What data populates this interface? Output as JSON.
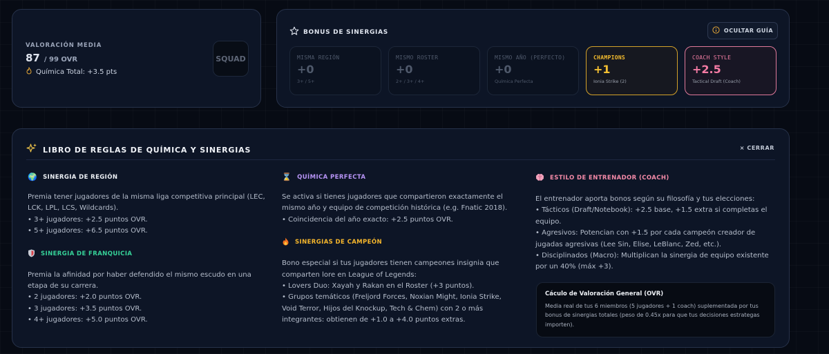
{
  "rating": {
    "label": "VALORACIÓN MEDIA",
    "value": "87",
    "max": "/ 99 OVR",
    "chemistry": "Química Total: +3.5 pts",
    "squad_badge": "SQUAD"
  },
  "synergy": {
    "title": "BONUS DE SINERGIAS",
    "guide_button": "OCULTAR GUÍA",
    "boxes": [
      {
        "title": "MISMA REGIÓN",
        "value": "+0",
        "sub": "3+ / 5+"
      },
      {
        "title": "MISMO ROSTER",
        "value": "+0",
        "sub": "2+ / 3+ / 4+"
      },
      {
        "title": "MISMO AÑO (PERFECTO)",
        "value": "+0",
        "sub": "Química Perfecta"
      },
      {
        "title": "CHAMPIONS",
        "value": "+1",
        "sub": "Ionia Strike (2)"
      },
      {
        "title": "COACH STYLE",
        "value": "+2.5",
        "sub": "Tactical Draft (Coach)"
      }
    ]
  },
  "rules": {
    "title": "LIBRO DE REGLAS DE QUÍMICA Y SINERGIAS",
    "close": "× CERRAR",
    "sections": {
      "region": {
        "title": "SINERGIA DE REGIÓN",
        "body": "Premia tener jugadores de la misma liga competitiva principal (LEC, LCK, LPL, LCS, Wildcards).\n• 3+ jugadores: +2.5 puntos OVR.\n• 5+ jugadores: +6.5 puntos OVR."
      },
      "franchise": {
        "title": "SINERGIA DE FRANQUICIA",
        "body": "Premia la afinidad por haber defendido el mismo escudo en una etapa de su carrera.\n• 2 jugadores: +2.0 puntos OVR.\n• 3 jugadores: +3.5 puntos OVR.\n• 4+ jugadores: +5.0 puntos OVR."
      },
      "perfect": {
        "title": "QUÍMICA PERFECTA",
        "body": "Se activa si tienes jugadores que compartieron exactamente el mismo año y equipo de competición histórica (e.g. Fnatic 2018).\n• Coincidencia del año exacto: +2.5 puntos OVR."
      },
      "champion": {
        "title": "SINERGIAS DE CAMPEÓN",
        "body": "Bono especial si tus jugadores tienen campeones insignia que comparten lore en League of Legends:\n• Lovers Duo: Xayah y Rakan en el Roster (+3 puntos).\n• Grupos temáticos (Freljord Forces, Noxian Might, Ionia Strike, Void Terror, Hijos del Knockup, Tech & Chem) con 2 o más integrantes: obtienen de +1.0 a +4.0 puntos extras."
      },
      "coach": {
        "title": "ESTILO DE ENTRENADOR (COACH)",
        "body": "El entrenador aporta bonos según su filosofía y tus elecciones:\n• Tácticos (Draft/Notebook): +2.5 base, +1.5 extra si completas el equipo.\n• Agresivos: Potencian con +1.5 por cada campeón creador de jugadas agresivas (Lee Sin, Elise, LeBlanc, Zed, etc.).\n• Disciplinados (Macro): Multiplican la sinergia de equipo existente por un 40% (máx +3)."
      }
    },
    "ovr_box": {
      "title": "Cáculo de Valoración General (OVR)",
      "body": "Media real de tus 6 miembros (5 jugadores + 1 coach) suplementada por tus bonus de sinergias totales (peso de 0.45x para que tus decisiones estrategas importen)."
    }
  },
  "icons": {
    "chemistry": "flame-outline-icon",
    "synergy": "star-outline-icon",
    "guide": "info-circle-icon",
    "rules": "sparkles-icon",
    "region": "globe-icon",
    "franchise": "shield-icon",
    "perfect": "hourglass-icon",
    "champion": "fire-icon",
    "coach": "brain-icon"
  },
  "colors": {
    "champions_accent": "#f5c032",
    "coach_accent": "#f47ba4",
    "franchise_title": "#36d399",
    "perfect_title": "#b794f6",
    "champion_title": "#f7b72c",
    "coach_title": "#f48aa8"
  }
}
